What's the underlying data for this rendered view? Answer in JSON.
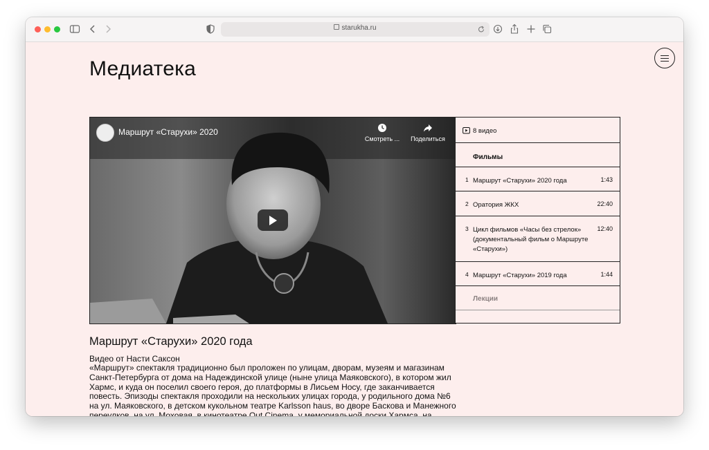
{
  "browser": {
    "url": "starukha.ru",
    "colors": {
      "close": "#fe5f57",
      "minimize": "#febc2e",
      "maximize": "#28c840"
    }
  },
  "page": {
    "title": "Медиатека",
    "background": "#fdeeed"
  },
  "player": {
    "video_title": "Маршрут «Старухи» 2020",
    "watch_later_label": "Смотреть ...",
    "share_label": "Поделиться"
  },
  "playlist": {
    "count_label": "8 видео",
    "sections": [
      {
        "label": "Фильмы",
        "items": [
          {
            "num": "1",
            "title": "Маршрут «Старухи» 2020 года",
            "duration": "1:43"
          },
          {
            "num": "2",
            "title": "Оратория ЖКХ",
            "duration": "22:40"
          },
          {
            "num": "3",
            "title": "Цикл фильмов «Часы без стрелок» (документальный фильм о Маршруте «Старухи»)",
            "duration": "12:40"
          },
          {
            "num": "4",
            "title": "Маршрут «Старухи» 2019 года",
            "duration": "1:44"
          }
        ]
      },
      {
        "label": "Лекции",
        "items": []
      }
    ]
  },
  "video_info": {
    "heading": "Маршрут «Старухи» 2020 года",
    "author": "Видео от Насти Саксон",
    "description": "«Маршрут» спектакля традиционно был проложен по улицам, дворам, музеям и магазинам Санкт-Петербурга от дома на Надеждинской улице (ныне улица Маяковского), в котором жил Хармс, и куда он поселил своего героя, до платформы в Лисьем Носу, где заканчивается повесть. Эпизоды спектакля проходили на нескольких улицах города, у родильного дома №6 на ул. Маяковского, в детском кукольном театре Karlsson haus, во дворе Баскова и Манежного переулков, на ул. Моховая, в кинотеатре Out Cinema, у мемориальной доски Хармса, на Воскресенской набережной у памятника жертвам"
  }
}
